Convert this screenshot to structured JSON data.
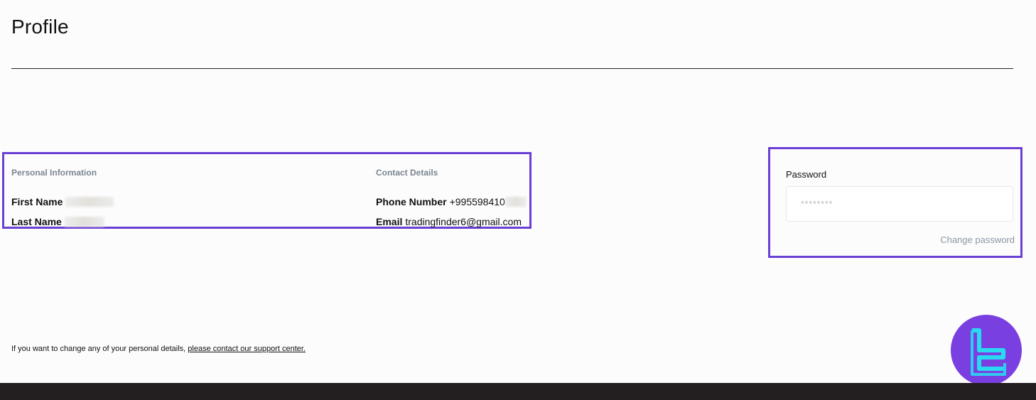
{
  "header": {
    "title": "Profile"
  },
  "personal_info": {
    "heading": "Personal Information",
    "first_name_label": "First Name",
    "last_name_label": "Last Name"
  },
  "contact_details": {
    "heading": "Contact Details",
    "phone_label": "Phone Number",
    "phone_value": "+995598410",
    "email_label": "Email",
    "email_value": "tradingfinder6@gmail.com"
  },
  "password": {
    "label": "Password",
    "value": "********",
    "change_link": "Change password"
  },
  "support": {
    "text": "If you want to change any of your personal details, ",
    "link": "please contact our support center."
  },
  "colors": {
    "accent": "#6a3fd4",
    "logo_bg": "#7a3fe0",
    "logo_mark": "#29d9f2",
    "footer": "#231f20"
  },
  "icons": {
    "logo": "tradingfinder-logo"
  }
}
